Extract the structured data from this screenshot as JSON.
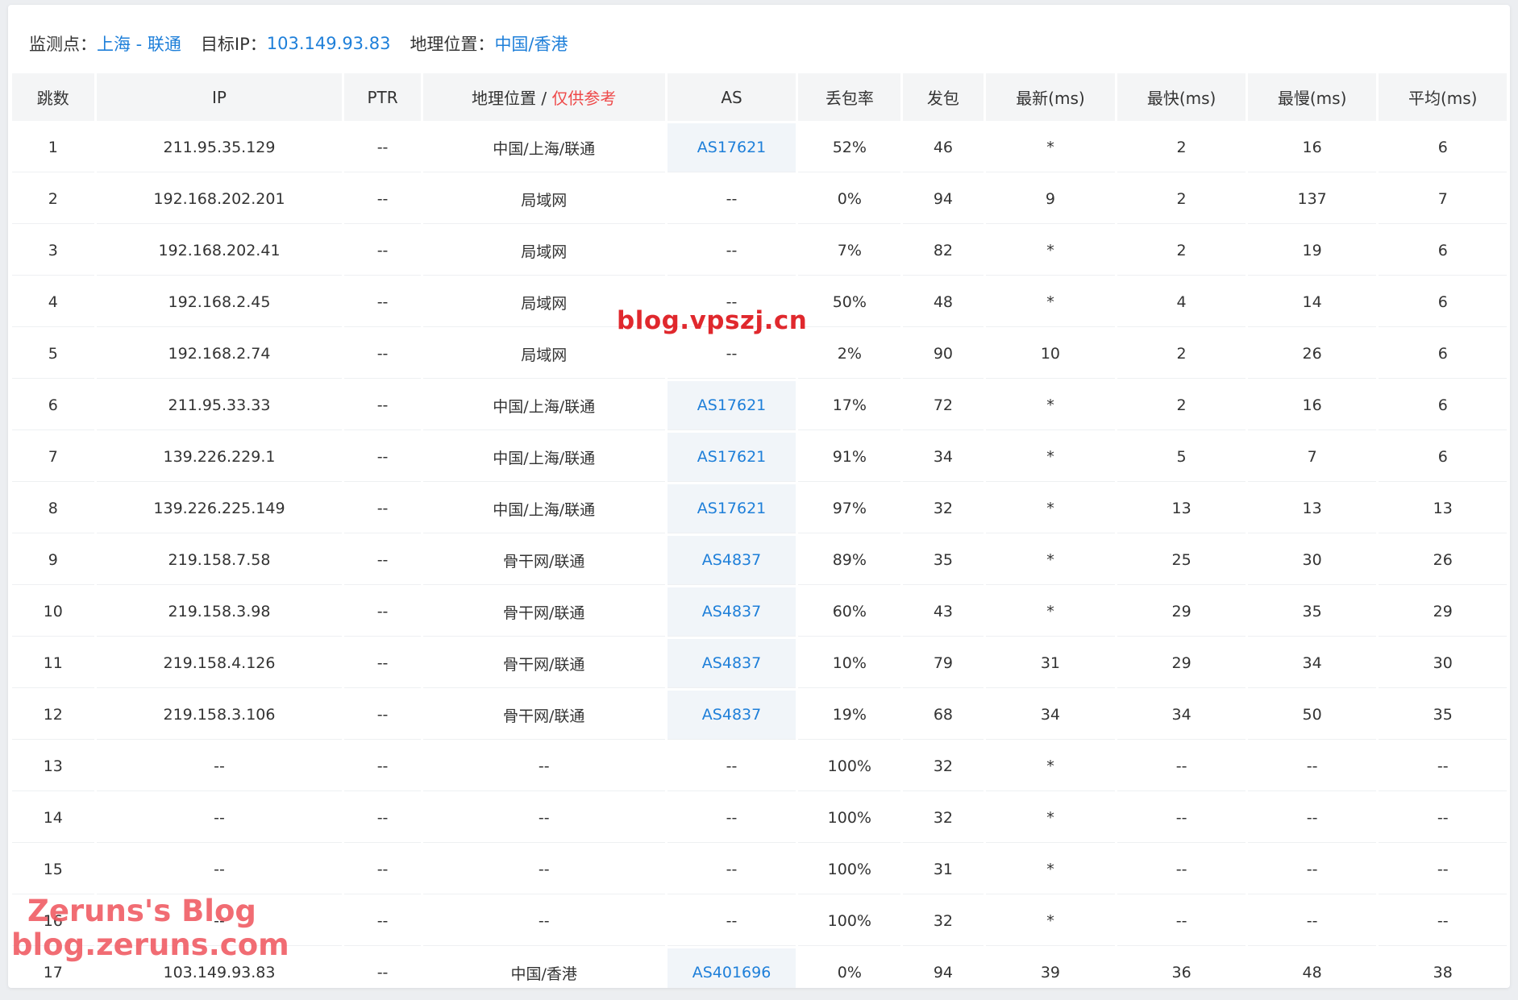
{
  "info": {
    "monitor_label": "监测点：",
    "monitor_value": "上海 - 联通",
    "target_label": "目标IP：",
    "target_value": "103.149.93.83",
    "geo_label": "地理位置：",
    "geo_value": "中国/香港"
  },
  "table": {
    "headers": {
      "hop": "跳数",
      "ip": "IP",
      "ptr": "PTR",
      "geo": "地理位置 / ",
      "geo_note": "仅供参考",
      "as": "AS",
      "loss": "丢包率",
      "sent": "发包",
      "last": "最新(ms)",
      "best": "最快(ms)",
      "worst": "最慢(ms)",
      "avg": "平均(ms)"
    },
    "rows": [
      {
        "hop": "1",
        "ip": "211.95.35.129",
        "ptr": "--",
        "geo": "中国/上海/联通",
        "as": "AS17621",
        "loss": "52%",
        "sent": "46",
        "last": "*",
        "best": "2",
        "worst": "16",
        "avg": "6"
      },
      {
        "hop": "2",
        "ip": "192.168.202.201",
        "ptr": "--",
        "geo": "局域网",
        "as": "--",
        "loss": "0%",
        "sent": "94",
        "last": "9",
        "best": "2",
        "worst": "137",
        "avg": "7"
      },
      {
        "hop": "3",
        "ip": "192.168.202.41",
        "ptr": "--",
        "geo": "局域网",
        "as": "--",
        "loss": "7%",
        "sent": "82",
        "last": "*",
        "best": "2",
        "worst": "19",
        "avg": "6"
      },
      {
        "hop": "4",
        "ip": "192.168.2.45",
        "ptr": "--",
        "geo": "局域网",
        "as": "--",
        "loss": "50%",
        "sent": "48",
        "last": "*",
        "best": "4",
        "worst": "14",
        "avg": "6"
      },
      {
        "hop": "5",
        "ip": "192.168.2.74",
        "ptr": "--",
        "geo": "局域网",
        "as": "--",
        "loss": "2%",
        "sent": "90",
        "last": "10",
        "best": "2",
        "worst": "26",
        "avg": "6"
      },
      {
        "hop": "6",
        "ip": "211.95.33.33",
        "ptr": "--",
        "geo": "中国/上海/联通",
        "as": "AS17621",
        "loss": "17%",
        "sent": "72",
        "last": "*",
        "best": "2",
        "worst": "16",
        "avg": "6"
      },
      {
        "hop": "7",
        "ip": "139.226.229.1",
        "ptr": "--",
        "geo": "中国/上海/联通",
        "as": "AS17621",
        "loss": "91%",
        "sent": "34",
        "last": "*",
        "best": "5",
        "worst": "7",
        "avg": "6"
      },
      {
        "hop": "8",
        "ip": "139.226.225.149",
        "ptr": "--",
        "geo": "中国/上海/联通",
        "as": "AS17621",
        "loss": "97%",
        "sent": "32",
        "last": "*",
        "best": "13",
        "worst": "13",
        "avg": "13"
      },
      {
        "hop": "9",
        "ip": "219.158.7.58",
        "ptr": "--",
        "geo": "骨干网/联通",
        "as": "AS4837",
        "loss": "89%",
        "sent": "35",
        "last": "*",
        "best": "25",
        "worst": "30",
        "avg": "26"
      },
      {
        "hop": "10",
        "ip": "219.158.3.98",
        "ptr": "--",
        "geo": "骨干网/联通",
        "as": "AS4837",
        "loss": "60%",
        "sent": "43",
        "last": "*",
        "best": "29",
        "worst": "35",
        "avg": "29"
      },
      {
        "hop": "11",
        "ip": "219.158.4.126",
        "ptr": "--",
        "geo": "骨干网/联通",
        "as": "AS4837",
        "loss": "10%",
        "sent": "79",
        "last": "31",
        "best": "29",
        "worst": "34",
        "avg": "30"
      },
      {
        "hop": "12",
        "ip": "219.158.3.106",
        "ptr": "--",
        "geo": "骨干网/联通",
        "as": "AS4837",
        "loss": "19%",
        "sent": "68",
        "last": "34",
        "best": "34",
        "worst": "50",
        "avg": "35"
      },
      {
        "hop": "13",
        "ip": "--",
        "ptr": "--",
        "geo": "--",
        "as": "--",
        "loss": "100%",
        "sent": "32",
        "last": "*",
        "best": "--",
        "worst": "--",
        "avg": "--"
      },
      {
        "hop": "14",
        "ip": "--",
        "ptr": "--",
        "geo": "--",
        "as": "--",
        "loss": "100%",
        "sent": "32",
        "last": "*",
        "best": "--",
        "worst": "--",
        "avg": "--"
      },
      {
        "hop": "15",
        "ip": "--",
        "ptr": "--",
        "geo": "--",
        "as": "--",
        "loss": "100%",
        "sent": "31",
        "last": "*",
        "best": "--",
        "worst": "--",
        "avg": "--"
      },
      {
        "hop": "16",
        "ip": "--",
        "ptr": "--",
        "geo": "--",
        "as": "--",
        "loss": "100%",
        "sent": "32",
        "last": "*",
        "best": "--",
        "worst": "--",
        "avg": "--"
      },
      {
        "hop": "17",
        "ip": "103.149.93.83",
        "ptr": "--",
        "geo": "中国/香港",
        "as": "AS401696",
        "loss": "0%",
        "sent": "94",
        "last": "39",
        "best": "36",
        "worst": "48",
        "avg": "38"
      }
    ]
  },
  "watermarks": {
    "center": "blog.vpszj.cn",
    "corner_line1": "Zeruns's Blog",
    "corner_line2": "blog.zeruns.com"
  },
  "colors": {
    "link_blue": "#1e7fd9",
    "note_red": "#ee4a4a",
    "header_bg": "#f4f5f6",
    "as_cell_bg": "#f1f5f9",
    "watermark_red": "#e0282d"
  }
}
